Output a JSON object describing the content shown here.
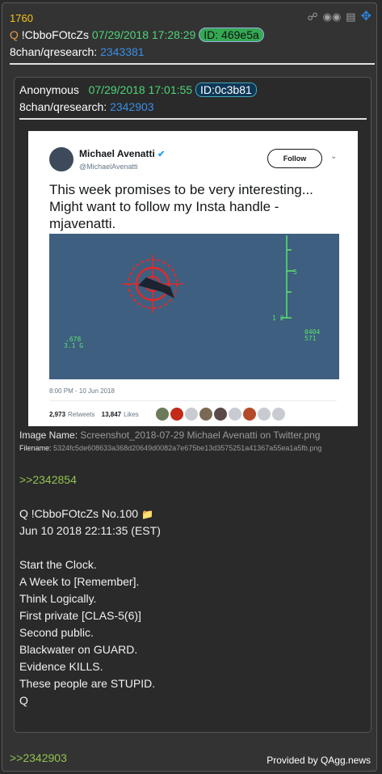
{
  "post": {
    "number": "1760",
    "q_mark": "Q",
    "tripcode": "!CbboFOtcZs",
    "timestamp": "07/29/2018 17:28:29",
    "id_label": "ID: 469e5a",
    "board": "8chan/qresearch:",
    "post_link": "2343381"
  },
  "tools": {
    "share_icon": "share-icon",
    "glasses_icon": "glasses-icon",
    "doc_icon": "document-icon",
    "move_icon": "move-icon"
  },
  "quote": {
    "author": "Anonymous",
    "timestamp": "07/29/2018 17:01:55",
    "id_label": "ID:0c3b81",
    "board": "8chan/qresearch:",
    "post_link": "2342903",
    "tweet": {
      "name": "Michael Avenatti",
      "handle": "@MichaelAvenatti",
      "follow_label": "Follow",
      "text_line1": "This week promises to be very interesting...",
      "text_line2": "Might want to follow my Insta handle -",
      "text_line3": "mjavenatti.",
      "hud_top_number": "5",
      "hud_left_number": "1 2",
      "hud_readout_left": ".678\n3.1 G",
      "hud_readout_right": "0404\n571",
      "date": "8:00 PM - 10 Jun 2018",
      "retweets_count": "2,973",
      "retweets_label": "Retweets",
      "likes_count": "13,847",
      "likes_label": "Likes"
    },
    "image_name_label": "Image Name:",
    "image_name": "Screenshot_2018-07-29 Michael Avenatti on Twitter.png",
    "filename_label": "Filename:",
    "filename": "5324fc5de608633a368d20649d0082a7e675be13d3575251a41367a55ea1a5fb.png",
    "reply_link": ">>2342854",
    "q_header": "Q !CbboFOtcZs No.100",
    "q_date": "Jun 10 2018 22:11:35 (EST)",
    "lines": [
      "Start the Clock.",
      "A Week to [Remember].",
      "Think Logically.",
      "First private [CLAS-5(6)]",
      "Second public.",
      "Blackwater on GUARD.",
      "Evidence KILLS.",
      "These people are STUPID.",
      "Q"
    ]
  },
  "footer": {
    "reply_link": ">>2342903",
    "provided_by": "Provided by QAgg.news"
  },
  "colors": {
    "background": "#333333",
    "number_yellow": "#f5c518",
    "timestamp_green": "#4fd37a",
    "link_blue": "#3a8ee6",
    "greentext": "#92c24f"
  }
}
